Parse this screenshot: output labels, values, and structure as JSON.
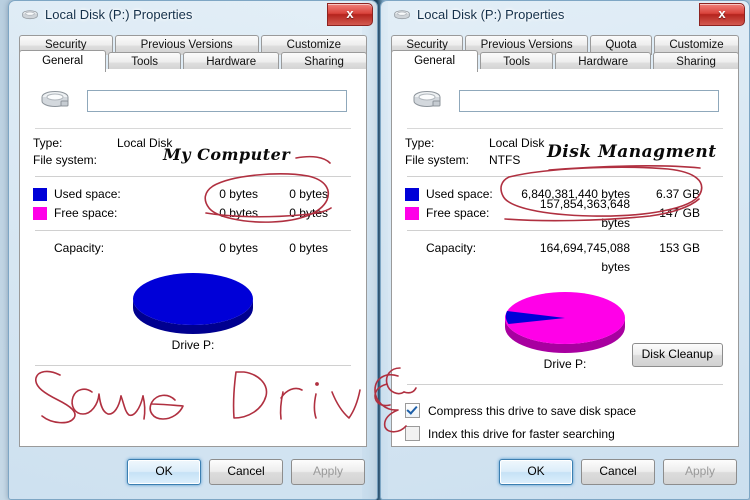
{
  "windows": [
    {
      "id": "left",
      "title": "Local Disk (P:) Properties",
      "close_label": "x",
      "tabs_top": [
        "Security",
        "Previous Versions",
        "Customize"
      ],
      "tabs_bottom": [
        "General",
        "Tools",
        "Hardware",
        "Sharing"
      ],
      "active_tab": "General",
      "volume_label": "",
      "volume_placeholder": "",
      "type_key": "Type:",
      "type_value": "Local Disk",
      "fs_key": "File system:",
      "fs_value": "",
      "used_label": "Used space:",
      "used_bytes": "0 bytes",
      "used_gb": "0 bytes",
      "free_label": "Free space:",
      "free_bytes": "0 bytes",
      "free_gb": "0 bytes",
      "capacity_label": "Capacity:",
      "capacity_bytes": "0 bytes",
      "capacity_gb": "0 bytes",
      "drive_caption": "Drive P:",
      "has_cleanup": false,
      "cleanup_label": "",
      "has_checks": false,
      "compress_label": "",
      "index_label": "",
      "compress_checked": false,
      "index_checked": false,
      "pie_used_pct": 100,
      "ok_label": "OK",
      "cancel_label": "Cancel",
      "apply_label": "Apply",
      "annotation": "My Computer"
    },
    {
      "id": "right",
      "title": "Local Disk (P:) Properties",
      "close_label": "x",
      "tabs_top": [
        "Security",
        "Previous Versions",
        "Quota",
        "Customize"
      ],
      "tabs_bottom": [
        "General",
        "Tools",
        "Hardware",
        "Sharing"
      ],
      "active_tab": "General",
      "volume_label": "",
      "volume_placeholder": "",
      "type_key": "Type:",
      "type_value": "Local Disk",
      "fs_key": "File system:",
      "fs_value": "NTFS",
      "used_label": "Used space:",
      "used_bytes": "6,840,381,440 bytes",
      "used_gb": "6.37 GB",
      "free_label": "Free space:",
      "free_bytes": "157,854,363,648 bytes",
      "free_gb": "147 GB",
      "capacity_label": "Capacity:",
      "capacity_bytes": "164,694,745,088 bytes",
      "capacity_gb": "153 GB",
      "drive_caption": "Drive P:",
      "has_cleanup": true,
      "cleanup_label": "Disk Cleanup",
      "has_checks": true,
      "compress_label": "Compress this drive to save disk space",
      "index_label": "Index this drive for faster searching",
      "compress_checked": true,
      "index_checked": false,
      "pie_used_pct": 4,
      "ok_label": "OK",
      "cancel_label": "Cancel",
      "apply_label": "Apply",
      "annotation": "Disk Managment"
    }
  ],
  "annotations": {
    "ink_color": "#b03040",
    "spanning_note": "Same Drive",
    "note_left": "My Computer",
    "note_right": "Disk Managment"
  },
  "colors": {
    "used_swatch": "#0000d8",
    "free_swatch": "#ff00e8",
    "accent": "#3c7fb1",
    "close_button": "#d9433c"
  }
}
